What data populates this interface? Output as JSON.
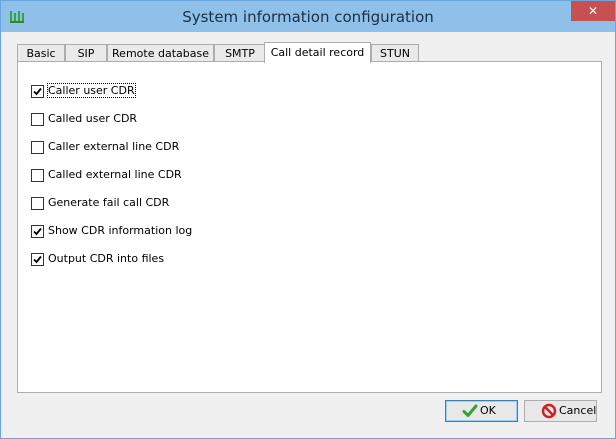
{
  "window": {
    "title": "System information configuration",
    "close_glyph": "✕",
    "accent_color": "#8fc0ea"
  },
  "tabs": [
    {
      "label": "Basic",
      "active": false
    },
    {
      "label": "SIP",
      "active": false
    },
    {
      "label": "Remote database",
      "active": false
    },
    {
      "label": "SMTP",
      "active": false
    },
    {
      "label": "Call detail record",
      "active": true
    },
    {
      "label": "STUN",
      "active": false
    }
  ],
  "options": [
    {
      "label": "Caller user CDR",
      "checked": true
    },
    {
      "label": "Called user CDR",
      "checked": false
    },
    {
      "label": "Caller external line CDR",
      "checked": false
    },
    {
      "label": "Called external line CDR",
      "checked": false
    },
    {
      "label": "Generate fail call CDR",
      "checked": false
    },
    {
      "label": "Show CDR information log",
      "checked": true
    },
    {
      "label": "Output CDR into files",
      "checked": true
    }
  ],
  "buttons": {
    "ok_label": "OK",
    "ok_icon": "green-checkmark-icon",
    "cancel_label": "Cancel",
    "cancel_icon": "red-no-entry-icon"
  }
}
